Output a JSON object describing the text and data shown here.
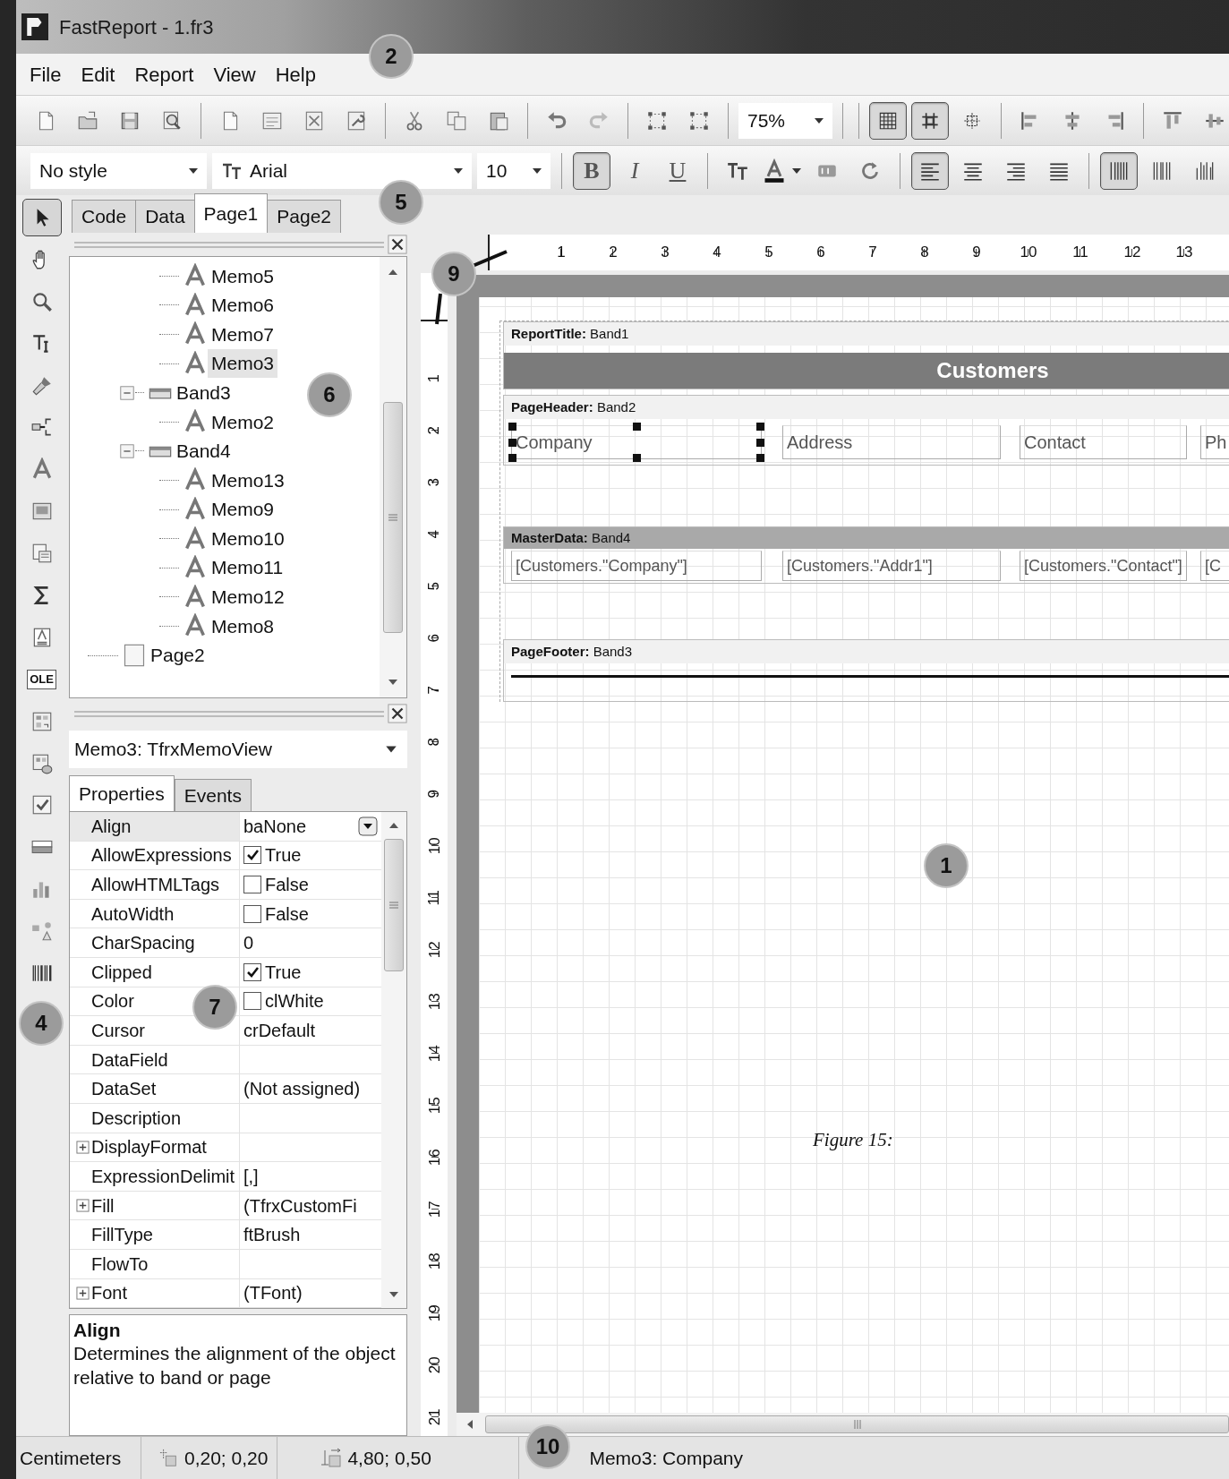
{
  "window": {
    "title": "FastReport - 1.fr3"
  },
  "menu": [
    {
      "label": "File"
    },
    {
      "label": "Edit"
    },
    {
      "label": "Report"
    },
    {
      "label": "View"
    },
    {
      "label": "Help"
    }
  ],
  "toolbar": {
    "zoom": "75%",
    "grid_buttons": [
      {
        "pressed": true
      },
      {
        "pressed": true
      },
      {
        "pressed": false
      }
    ]
  },
  "format_toolbar": {
    "style": "No style",
    "font": "Arial",
    "size": "10",
    "format_buttons": [
      {
        "label": "B",
        "pressed": true
      },
      {
        "label": "I",
        "pressed": false
      },
      {
        "label": "U",
        "pressed": false
      }
    ],
    "align_buttons": [
      {
        "pressed": true
      },
      {
        "pressed": false
      },
      {
        "pressed": false
      },
      {
        "pressed": false
      }
    ],
    "frame_buttons": [
      {
        "pressed": true
      },
      {
        "pressed": false
      },
      {
        "pressed": false
      }
    ]
  },
  "tools": [
    {
      "kind": "pointer",
      "selected": true
    },
    {
      "kind": "hand",
      "selected": false
    },
    {
      "kind": "zoom",
      "selected": false
    },
    {
      "kind": "text_edit",
      "selected": false
    },
    {
      "kind": "painter",
      "selected": false
    },
    {
      "kind": "band",
      "selected": false
    },
    {
      "kind": "text",
      "selected": false
    },
    {
      "kind": "picture",
      "selected": false
    },
    {
      "kind": "subreport",
      "selected": false
    },
    {
      "kind": "sum",
      "selected": false
    },
    {
      "kind": "sysmemo",
      "selected": false
    },
    {
      "kind": "ole",
      "label": "OLE",
      "selected": false
    },
    {
      "kind": "cross",
      "selected": false
    },
    {
      "kind": "dbcross",
      "selected": false
    },
    {
      "kind": "checkbox",
      "selected": false
    },
    {
      "kind": "gradient",
      "selected": false
    },
    {
      "kind": "chart",
      "selected": false
    },
    {
      "kind": "shape",
      "selected": false
    },
    {
      "kind": "barcode",
      "selected": false
    }
  ],
  "design_tabs": [
    {
      "label": "Code",
      "selected": false
    },
    {
      "label": "Data",
      "selected": false
    },
    {
      "label": "Page1",
      "selected": true
    },
    {
      "label": "Page2",
      "selected": false
    }
  ],
  "object_tree": {
    "items": [
      {
        "kind": "memo",
        "label": "Memo5",
        "selected": false
      },
      {
        "kind": "memo",
        "label": "Memo6",
        "selected": false
      },
      {
        "kind": "memo",
        "label": "Memo7",
        "selected": false
      },
      {
        "kind": "memo",
        "label": "Memo3",
        "selected": true
      },
      {
        "kind": "band",
        "label": "Band3",
        "selected": false,
        "expanded": true,
        "children": [
          {
            "kind": "memo",
            "label": "Memo2",
            "selected": false
          }
        ]
      },
      {
        "kind": "band",
        "label": "Band4",
        "selected": false,
        "expanded": true,
        "children": [
          {
            "kind": "memo",
            "label": "Memo13",
            "selected": false
          },
          {
            "kind": "memo",
            "label": "Memo9",
            "selected": false
          },
          {
            "kind": "memo",
            "label": "Memo10",
            "selected": false
          },
          {
            "kind": "memo",
            "label": "Memo11",
            "selected": false
          },
          {
            "kind": "memo",
            "label": "Memo12",
            "selected": false
          },
          {
            "kind": "memo",
            "label": "Memo8",
            "selected": false
          }
        ]
      },
      {
        "kind": "page",
        "label": "Page2",
        "selected": false
      }
    ]
  },
  "object_inspector": {
    "object": "Memo3: TfrxMemoView",
    "tabs": [
      {
        "label": "Properties",
        "selected": true
      },
      {
        "label": "Events",
        "selected": false
      }
    ],
    "properties": [
      {
        "name": "Align",
        "value": "baNone",
        "kind": "combo",
        "expandable": false,
        "selected": true
      },
      {
        "name": "AllowExpressions",
        "value": "True",
        "kind": "check",
        "checked": true,
        "expandable": false,
        "selected": false
      },
      {
        "name": "AllowHTMLTags",
        "value": "False",
        "kind": "check",
        "checked": false,
        "expandable": false,
        "selected": false
      },
      {
        "name": "AutoWidth",
        "value": "False",
        "kind": "check",
        "checked": false,
        "expandable": false,
        "selected": false
      },
      {
        "name": "CharSpacing",
        "value": "0",
        "kind": "text",
        "expandable": false,
        "selected": false
      },
      {
        "name": "Clipped",
        "value": "True",
        "kind": "check",
        "checked": true,
        "expandable": false,
        "selected": false
      },
      {
        "name": "Color",
        "value": "clWhite",
        "kind": "color",
        "color": "#ffffff",
        "expandable": false,
        "selected": false
      },
      {
        "name": "Cursor",
        "value": "crDefault",
        "kind": "text",
        "expandable": false,
        "selected": false
      },
      {
        "name": "DataField",
        "kind": "text",
        "expandable": false,
        "selected": false
      },
      {
        "name": "DataSet",
        "value": "(Not assigned)",
        "kind": "text",
        "expandable": false,
        "selected": false
      },
      {
        "name": "Description",
        "kind": "text",
        "expandable": false,
        "selected": false
      },
      {
        "name": "DisplayFormat",
        "kind": "text",
        "expandable": true,
        "selected": false
      },
      {
        "name": "ExpressionDelimit",
        "value": "[,]",
        "kind": "text",
        "expandable": false,
        "selected": false
      },
      {
        "name": "Fill",
        "value": "(TfrxCustomFi",
        "kind": "text",
        "expandable": true,
        "selected": false
      },
      {
        "name": "FillType",
        "value": "ftBrush",
        "kind": "text",
        "expandable": false,
        "selected": false
      },
      {
        "name": "FlowTo",
        "kind": "text",
        "expandable": false,
        "selected": false
      },
      {
        "name": "Font",
        "value": "(TFont)",
        "kind": "text",
        "expandable": true,
        "selected": false
      }
    ],
    "description": {
      "title": "Align",
      "text": "Determines the alignment of the object relative to band or page"
    }
  },
  "horizontal_ruler": [
    "1",
    "2",
    "3",
    "4",
    "5",
    "6",
    "7",
    "8",
    "9",
    "10",
    "11",
    "12",
    "13"
  ],
  "vertical_ruler": [
    "1",
    "2",
    "3",
    "4",
    "5",
    "6",
    "7",
    "8",
    "9",
    "10",
    "11",
    "12",
    "13",
    "14",
    "15",
    "16",
    "17",
    "18",
    "19",
    "20",
    "21"
  ],
  "report_page": {
    "bands": [
      {
        "kind": "title",
        "label": "**ReportTitle:** Band1",
        "memos": [
          {
            "text": "Customers",
            "selected": false
          }
        ]
      },
      {
        "kind": "header",
        "label": "**PageHeader:** Band2",
        "memos": [
          {
            "text": "Company",
            "selected": true
          },
          {
            "text": "Address",
            "selected": false
          },
          {
            "text": "Contact",
            "selected": false
          },
          {
            "text": "Ph",
            "selected": false
          }
        ]
      },
      {
        "kind": "data",
        "label": "**MasterData:** Band4",
        "memos": [
          {
            "text": "[Customers.\"Company\"]",
            "selected": false
          },
          {
            "text": "[Customers.\"Addr1\"]",
            "selected": false
          },
          {
            "text": "[Customers.\"Contact\"]",
            "selected": false
          },
          {
            "text": "[C",
            "selected": false
          }
        ]
      },
      {
        "kind": "footer",
        "label": "**PageFooter:** Band3"
      }
    ],
    "caption": "Figure 15:"
  },
  "status_bar": {
    "units": "Centimeters",
    "position": "0,20; 0,20",
    "size": "4,80; 0,50",
    "object": "Memo3: Company"
  },
  "callouts": [
    {
      "label": "2"
    },
    {
      "label": "5"
    },
    {
      "label": "9"
    },
    {
      "label": "6"
    },
    {
      "label": "1"
    },
    {
      "label": "7"
    },
    {
      "label": "4"
    },
    {
      "label": "10"
    }
  ]
}
